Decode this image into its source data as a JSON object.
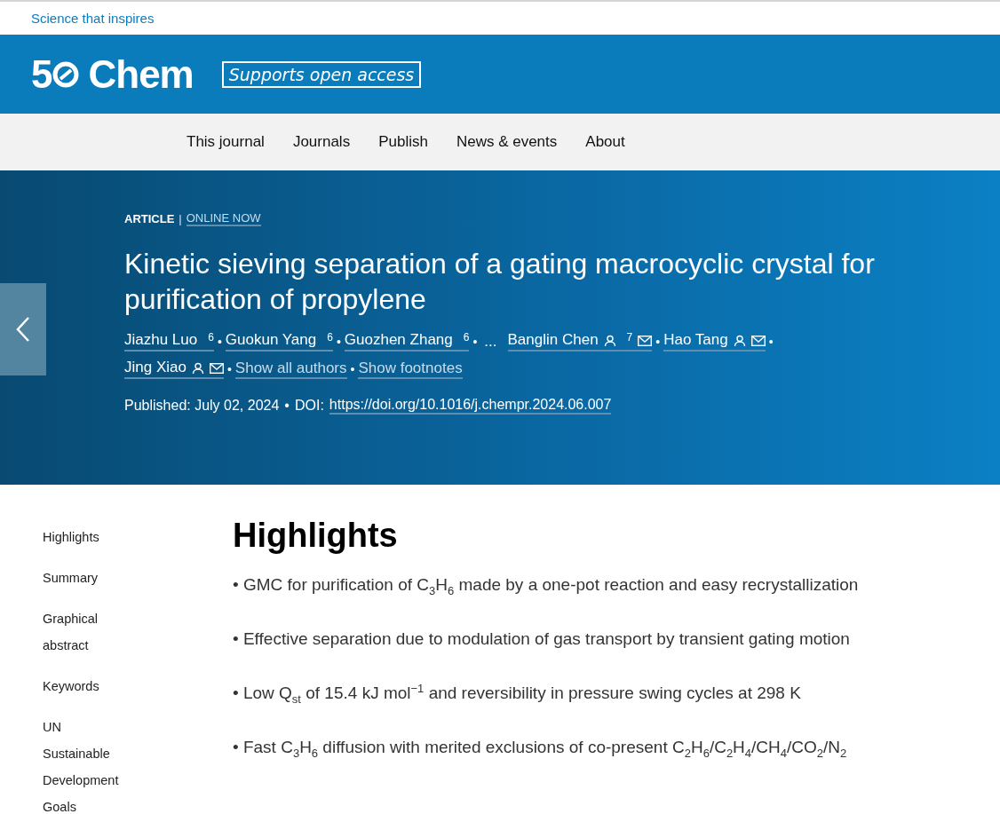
{
  "top_bar": {
    "tagline": "Science that inspires"
  },
  "header": {
    "logo": {
      "prefix": "5",
      "name": "Chem"
    },
    "badge": "Supports open access"
  },
  "nav": {
    "items": [
      {
        "label": "This journal"
      },
      {
        "label": "Journals"
      },
      {
        "label": "Publish"
      },
      {
        "label": "News & events"
      },
      {
        "label": "About"
      }
    ]
  },
  "article": {
    "type": "ARTICLE",
    "divider": "|",
    "status": "ONLINE NOW",
    "title": "Kinetic sieving separation of a gating macrocyclic crystal for purification of propylene",
    "authors": [
      {
        "kind": "author",
        "name": "Jiazhu Luo",
        "sup": "6",
        "person": false,
        "mail": false,
        "sep": "•"
      },
      {
        "kind": "author",
        "name": "Guokun Yang",
        "sup": "6",
        "person": false,
        "mail": false,
        "sep": "•"
      },
      {
        "kind": "author",
        "name": "Guozhen Zhang",
        "sup": "6",
        "person": false,
        "mail": false,
        "sep": "•"
      },
      {
        "kind": "ellipsis",
        "name": "..."
      },
      {
        "kind": "author",
        "name": "Banglin Chen",
        "sup": "7",
        "person": true,
        "mail": true,
        "sep": "•"
      },
      {
        "kind": "author",
        "name": "Hao Tang",
        "person": true,
        "mail": true,
        "sep": "•"
      },
      {
        "kind": "author",
        "name": "Jing Xiao",
        "person": true,
        "mail": true,
        "sep": "•"
      },
      {
        "kind": "link",
        "name": "Show all authors",
        "sep": "•"
      },
      {
        "kind": "link",
        "name": "Show footnotes"
      }
    ],
    "published": "Published: July 02, 2024",
    "pub_sep": "•",
    "doi_label": "DOI:",
    "doi": "https://doi.org/10.1016/j.chempr.2024.06.007"
  },
  "sidebar": {
    "items": [
      {
        "label": "Highlights"
      },
      {
        "label": "Summary"
      },
      {
        "label": "Graphical abstract"
      },
      {
        "label": "Keywords"
      },
      {
        "label": "UN Sustainable Development Goals"
      }
    ]
  },
  "highlights": {
    "heading": "Highlights",
    "items": [
      "• GMC for purification of C$_{3}$H$_{6}$ made by a one-pot reaction and easy recrystallization",
      "• Effective separation due to modulation of gas transport by transient gating motion",
      "• Low Q$_{st}$ of 15.4 kJ mol$^{−1}$ and reversibility in pressure swing cycles at 298 K",
      "• Fast C$_{3}$H$_{6}$ diffusion with merited exclusions of co-present C$_{2}$H$_{6}$/C$_{2}$H$_{4}$/CH$_{4}$/CO$_{2}$/N$_{2}$"
    ]
  }
}
